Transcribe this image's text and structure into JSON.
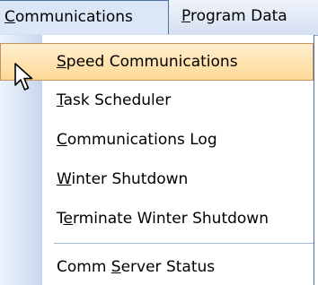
{
  "menubar": {
    "items": [
      {
        "pre": "",
        "key": "C",
        "post": "ommunications"
      },
      {
        "pre": "",
        "key": "P",
        "post": "rogram Data"
      }
    ]
  },
  "menu": {
    "items": [
      {
        "pre": "",
        "key": "S",
        "post": "peed Communications"
      },
      {
        "pre": "",
        "key": "T",
        "post": "ask Scheduler"
      },
      {
        "pre": "",
        "key": "C",
        "post": "ommunications Log"
      },
      {
        "pre": "",
        "key": "W",
        "post": "inter Shutdown"
      },
      {
        "pre": "T",
        "key": "e",
        "post": "rminate Winter Shutdown"
      },
      {
        "pre": "Comm ",
        "key": "S",
        "post": "erver Status"
      }
    ]
  },
  "colors": {
    "highlight_fill": "#fdd996",
    "highlight_border": "#c9925a",
    "gutter": "#c6d6ee",
    "menu_border": "#4d6fa3"
  },
  "icons": {
    "cursor": "mouse-pointer-icon"
  }
}
